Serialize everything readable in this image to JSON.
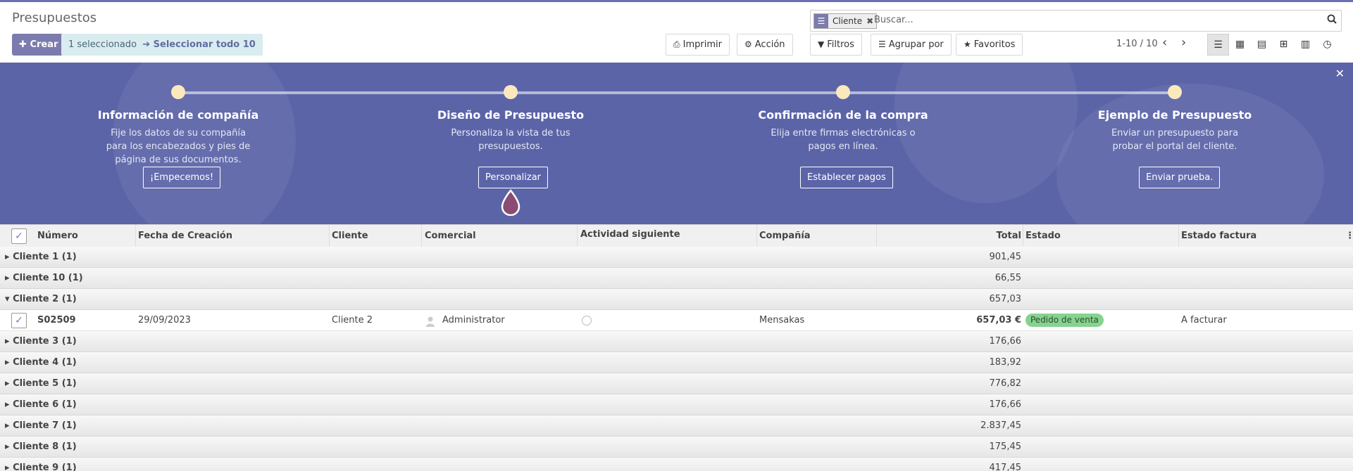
{
  "breadcrumb": "Presupuestos",
  "buttons": {
    "create": "Crear",
    "print": "Imprimir",
    "action": "Acción",
    "filters": "Filtros",
    "group_by": "Agrupar por",
    "favorites": "Favoritos"
  },
  "selection": {
    "count_text": "1 seleccionado",
    "select_all": "Seleccionar todo 10"
  },
  "search": {
    "facet_value": "Cliente",
    "placeholder": "Buscar..."
  },
  "pager": {
    "value": "1-10 / 10"
  },
  "views": [
    "list-icon",
    "kanban-icon",
    "calendar-icon",
    "pivot-icon",
    "graph-icon",
    "activity-icon"
  ],
  "onboarding": {
    "steps": [
      {
        "title": "Información de compañía",
        "desc": "Fije los datos de su compañía para los encabezados y pies de página de sus documentos.",
        "button": "¡Empecemos!"
      },
      {
        "title": "Diseño de Presupuesto",
        "desc": "Personaliza la vista de tus presupuestos.",
        "button": "Personalizar"
      },
      {
        "title": "Confirmación de la compra",
        "desc": "Elija entre firmas electrónicas o pagos en línea.",
        "button": "Establecer pagos"
      },
      {
        "title": "Ejemplo de Presupuesto",
        "desc": "Enviar un presupuesto para probar el portal del cliente.",
        "button": "Enviar prueba."
      }
    ]
  },
  "table": {
    "columns": {
      "number": "Número",
      "date": "Fecha de Creación",
      "customer": "Cliente",
      "salesperson": "Comercial",
      "activity": "Actividad siguiente",
      "company": "Compañía",
      "total": "Total",
      "status": "Estado",
      "invoice_status": "Estado factura"
    },
    "groups": [
      {
        "name": "Cliente 1 (1)",
        "total": "901,45"
      },
      {
        "name": "Cliente 10 (1)",
        "total": "66,55"
      },
      {
        "name": "Cliente 2 (1)",
        "total": "657,03"
      },
      {
        "name": "Cliente 3 (1)",
        "total": "176,66"
      },
      {
        "name": "Cliente 4 (1)",
        "total": "183,92"
      },
      {
        "name": "Cliente 5 (1)",
        "total": "776,82"
      },
      {
        "name": "Cliente 6 (1)",
        "total": "176,66"
      },
      {
        "name": "Cliente 7 (1)",
        "total": "2.837,45"
      },
      {
        "name": "Cliente 8 (1)",
        "total": "175,45"
      },
      {
        "name": "Cliente 9 (1)",
        "total": "417,45"
      }
    ],
    "expanded_record": {
      "number": "S02509",
      "date": "29/09/2023",
      "customer": "Cliente 2",
      "salesperson": "Administrator",
      "company": "Mensakas",
      "total": "657,03 €",
      "status": "Pedido de venta",
      "invoice_status": "A facturar"
    }
  },
  "colors": {
    "brand": "#7c7bad",
    "banner": "#5c64a8",
    "badge_green": "#86d38f"
  }
}
